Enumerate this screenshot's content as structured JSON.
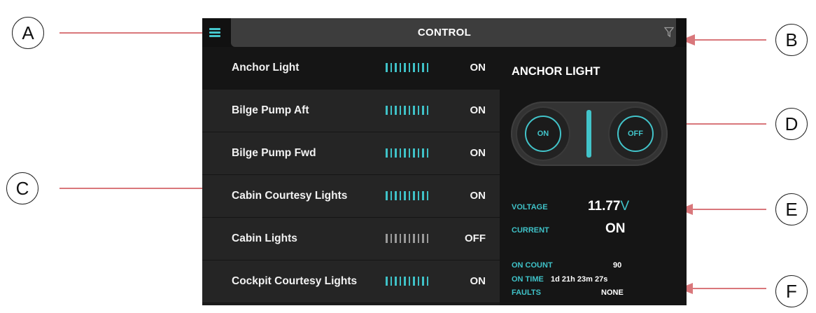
{
  "callouts": {
    "a": "A",
    "b": "B",
    "c": "C",
    "d": "D",
    "e": "E",
    "f": "F"
  },
  "header": {
    "title": "CONTROL",
    "menu_icon": "hamburger-menu-icon",
    "filter_icon": "filter-funnel-icon"
  },
  "circuits": [
    {
      "label": "Anchor Light",
      "state": "ON",
      "selected": true
    },
    {
      "label": "Bilge Pump Aft",
      "state": "ON"
    },
    {
      "label": "Bilge Pump Fwd",
      "state": "ON"
    },
    {
      "label": "Cabin Courtesy Lights",
      "state": "ON"
    },
    {
      "label": "Cabin Lights",
      "state": "OFF"
    },
    {
      "label": "Cockpit Courtesy Lights",
      "state": "ON"
    }
  ],
  "detail": {
    "title": "ANCHOR LIGHT",
    "switch": {
      "on_label": "ON",
      "off_label": "OFF"
    },
    "voltage_label": "VOLTAGE",
    "voltage_value": "11.77",
    "voltage_unit": "V",
    "current_label": "CURRENT",
    "current_value": "ON",
    "on_count_label": "ON COUNT",
    "on_count_value": "90",
    "on_time_label": "ON TIME",
    "on_time_value": "1d 21h 23m 27s",
    "faults_label": "FAULTS",
    "faults_value": "NONE"
  },
  "colors": {
    "accent": "#3fc2c8",
    "arrow": "#d9777b",
    "off_bars": "#9a9a9a"
  }
}
